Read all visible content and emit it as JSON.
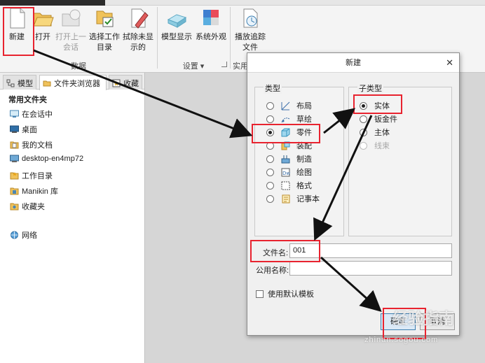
{
  "ribbon": {
    "buttons": [
      {
        "id": "new",
        "label": "新建",
        "icon": "new-document-icon"
      },
      {
        "id": "open",
        "label": "打开",
        "icon": "open-folder-icon"
      },
      {
        "id": "open_last",
        "label_line1": "打开上一",
        "label_line2": "会话",
        "icon": "open-last-session-icon",
        "disabled": true
      },
      {
        "id": "select_working_dir",
        "label_line1": "选择工作",
        "label_line2": "目录",
        "icon": "select-working-directory-icon"
      },
      {
        "id": "erase_not_displayed",
        "label_line1": "拭除未显",
        "label_line2": "示的",
        "icon": "erase-not-displayed-icon"
      },
      {
        "id": "model_display",
        "label": "模型显示",
        "icon": "model-display-icon"
      },
      {
        "id": "system_appearance",
        "label": "系统外观",
        "icon": "system-appearance-icon"
      },
      {
        "id": "playback_trail",
        "label_line1": "播放追踪",
        "label_line2": "文件",
        "icon": "playback-trail-icon"
      }
    ],
    "groups": {
      "data": "数据",
      "settings": "设置",
      "utilities": "实用"
    }
  },
  "left_panel": {
    "tabs": [
      "模型",
      "文件夹浏览器",
      "收藏"
    ],
    "section_title": "常用文件夹",
    "items": [
      {
        "label": "在会话中",
        "icon": "in-session-icon"
      },
      {
        "label": "桌面",
        "icon": "desktop-icon"
      },
      {
        "label": "我的文档",
        "icon": "my-documents-icon"
      },
      {
        "label": "desktop-en4mp72",
        "icon": "computer-icon"
      },
      {
        "label": "工作目录",
        "icon": "working-directory-icon"
      },
      {
        "label": "Manikin 库",
        "icon": "manikin-library-icon"
      },
      {
        "label": "收藏夹",
        "icon": "favorites-icon"
      },
      {
        "label": "网络",
        "icon": "network-icon"
      }
    ]
  },
  "dialog": {
    "title": "新建",
    "type_legend": "类型",
    "types": [
      {
        "label": "布局",
        "icon": "layout-icon",
        "selected": false
      },
      {
        "label": "草绘",
        "icon": "sketch-icon",
        "selected": false
      },
      {
        "label": "零件",
        "icon": "part-icon",
        "selected": true
      },
      {
        "label": "装配",
        "icon": "assembly-icon",
        "selected": false
      },
      {
        "label": "制造",
        "icon": "manufacturing-icon",
        "selected": false
      },
      {
        "label": "绘图",
        "icon": "drawing-icon",
        "selected": false
      },
      {
        "label": "格式",
        "icon": "format-icon",
        "selected": false
      },
      {
        "label": "记事本",
        "icon": "notebook-icon",
        "selected": false
      }
    ],
    "subtype_legend": "子类型",
    "subtypes": [
      {
        "label": "实体",
        "selected": true,
        "disabled": false
      },
      {
        "label": "钣金件",
        "selected": false,
        "disabled": false
      },
      {
        "label": "主体",
        "selected": false,
        "disabled": false
      },
      {
        "label": "线束",
        "selected": false,
        "disabled": true
      }
    ],
    "filename_label": "文件名:",
    "filename_value": "001",
    "common_name_label": "公用名称:",
    "common_name_value": "",
    "use_default_template_label": "使用默认模板",
    "use_default_template_checked": false,
    "ok_label": "确定",
    "cancel_label": "取消"
  },
  "watermark": {
    "text": "经验指南",
    "sub": "zhinan.sogou.com"
  },
  "colors": {
    "highlight": "#e8232f",
    "arrow": "#111111",
    "accent": "#3c7fb1"
  }
}
